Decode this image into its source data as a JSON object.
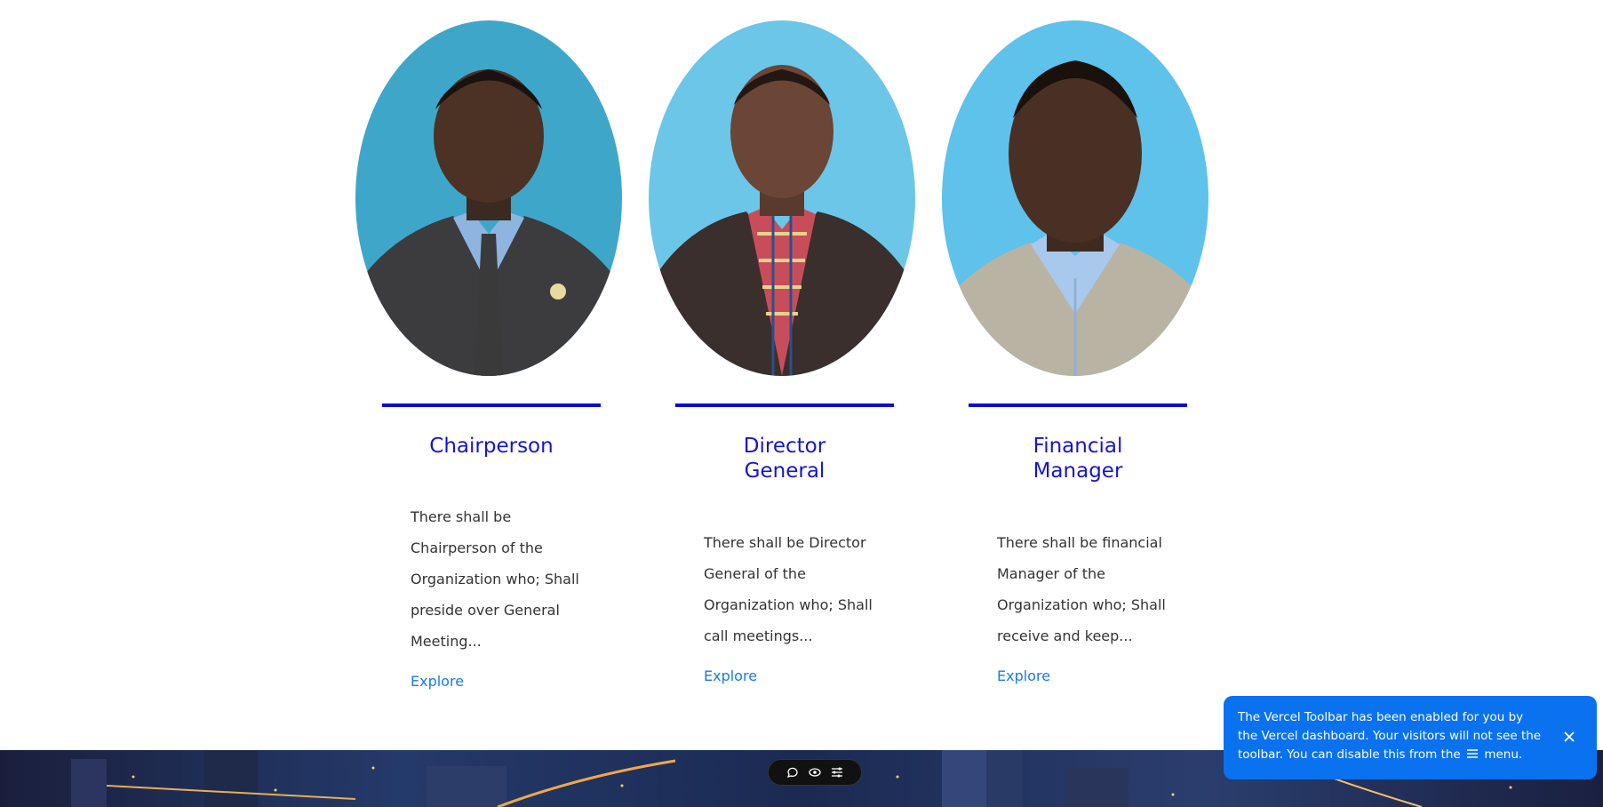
{
  "cards": [
    {
      "title_lines": [
        "Chairperson"
      ],
      "description": "There shall be Chairperson of the Organization who; Shall preside over General Meeting...",
      "link_label": "Explore",
      "photo_bg": "#3ea7c9"
    },
    {
      "title_lines": [
        "Director",
        "General"
      ],
      "description": "There shall be Director General of the Organization who; Shall call meetings...",
      "link_label": "Explore",
      "photo_bg": "#6cc6e8"
    },
    {
      "title_lines": [
        "Financial",
        "Manager"
      ],
      "description": "There shall be financial Manager of the Organization who; Shall receive and keep...",
      "link_label": "Explore",
      "photo_bg": "#5ec2ea"
    }
  ],
  "vercel_toolbar": {
    "icons": [
      "comment-icon",
      "eye-icon",
      "menu-icon"
    ]
  },
  "toast": {
    "text_before_menu": "The Vercel Toolbar has been enabled for you by the Vercel dashboard. Your visitors will not see the toolbar. You can disable this from the",
    "text_after_menu": "menu."
  },
  "colors": {
    "accent_blue": "#1515d0",
    "rule_blue": "#0a0ad6",
    "link_blue": "#1a7ae0",
    "toast_bg": "#0a72ef"
  }
}
